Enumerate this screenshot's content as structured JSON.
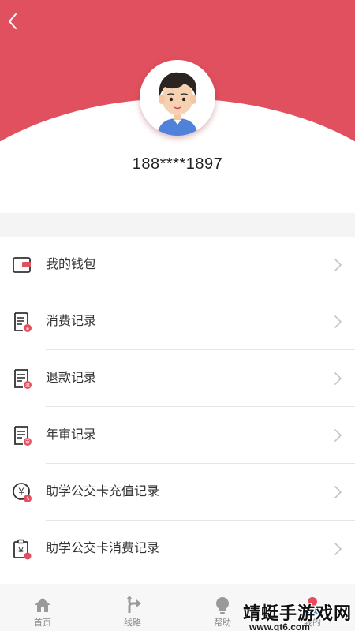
{
  "colors": {
    "brand_red": "#e1505e",
    "badge_red": "#e84a5f",
    "text": "#333333",
    "muted": "#8a8a8a"
  },
  "header": {
    "back_icon": "chevron-left-icon",
    "avatar": "user-avatar-icon",
    "phone": "188****1897"
  },
  "menu": {
    "items": [
      {
        "label": "我的钱包",
        "icon": "wallet-icon"
      },
      {
        "label": "消费记录",
        "icon": "consumption-record-icon"
      },
      {
        "label": "退款记录",
        "icon": "refund-record-icon"
      },
      {
        "label": "年审记录",
        "icon": "annual-review-icon"
      },
      {
        "label": "助学公交卡充值记录",
        "icon": "yuan-recharge-icon"
      },
      {
        "label": "助学公交卡消费记录",
        "icon": "clipboard-yuan-icon"
      }
    ]
  },
  "tabbar": {
    "tabs": [
      {
        "label": "首页",
        "icon": "home-icon"
      },
      {
        "label": "线路",
        "icon": "route-icon"
      },
      {
        "label": "帮助",
        "icon": "lightbulb-icon"
      },
      {
        "label": "我的",
        "icon": "profile-icon"
      }
    ]
  },
  "watermark": {
    "title": "靖蜓手游戏网",
    "url": "www.qt6.com"
  }
}
